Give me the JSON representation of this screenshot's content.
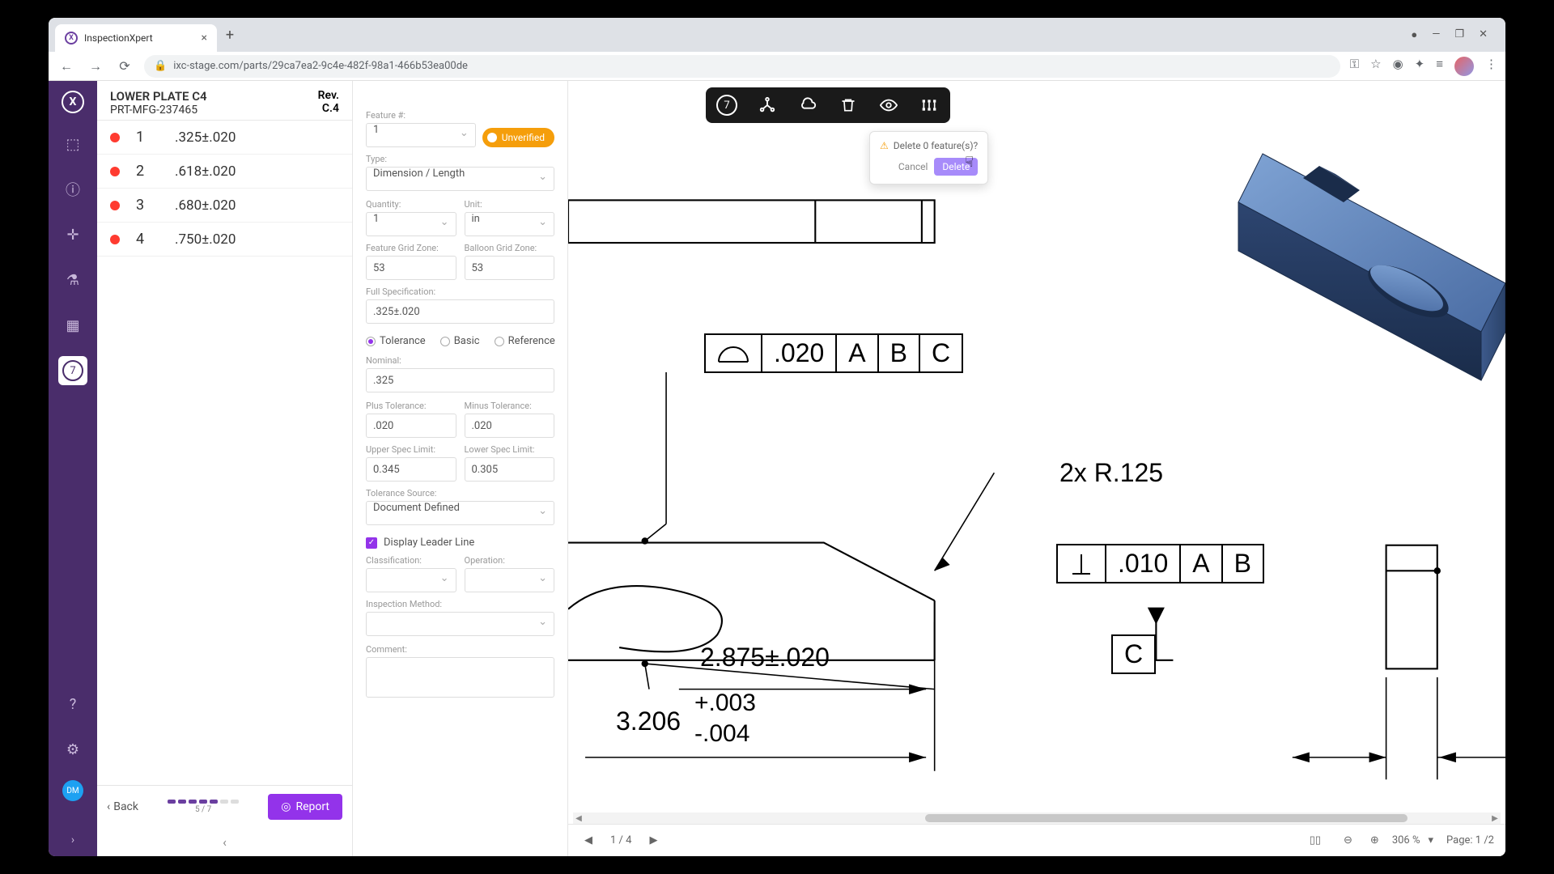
{
  "browser": {
    "tab_title": "InspectionXpert",
    "url": "ixc-stage.com/parts/29ca7ea2-9c4e-482f-98a1-466b53ea00de"
  },
  "part": {
    "name": "LOWER PLATE C4",
    "number": "PRT-MFG-237465",
    "rev_label": "Rev.",
    "rev": "C.4"
  },
  "features": [
    {
      "num": "1",
      "value": ".325±.020"
    },
    {
      "num": "2",
      "value": ".618±.020"
    },
    {
      "num": "3",
      "value": ".680±.020"
    },
    {
      "num": "4",
      "value": ".750±.020"
    }
  ],
  "sidebar_footer": {
    "back": "Back",
    "progress_text": "5 / 7",
    "report": "Report"
  },
  "inspector": {
    "feature_num_label": "Feature #:",
    "feature_num": "1",
    "status": "Unverified",
    "type_label": "Type:",
    "type": "Dimension / Length",
    "quantity_label": "Quantity:",
    "quantity": "1",
    "unit_label": "Unit:",
    "unit": "in",
    "fgz_label": "Feature Grid Zone:",
    "fgz": "53",
    "bgz_label": "Balloon Grid Zone:",
    "bgz": "53",
    "spec_label": "Full Specification:",
    "spec": ".325±.020",
    "tol_mode": {
      "tolerance": "Tolerance",
      "basic": "Basic",
      "reference": "Reference"
    },
    "nominal_label": "Nominal:",
    "nominal": ".325",
    "plus_tol_label": "Plus Tolerance:",
    "plus_tol": ".020",
    "minus_tol_label": "Minus Tolerance:",
    "minus_tol": ".020",
    "usl_label": "Upper Spec Limit:",
    "usl": "0.345",
    "lsl_label": "Lower Spec Limit:",
    "lsl": "0.305",
    "tol_source_label": "Tolerance Source:",
    "tol_source": "Document Defined",
    "leader_label": "Display Leader Line",
    "classification_label": "Classification:",
    "operation_label": "Operation:",
    "method_label": "Inspection Method:",
    "comment_label": "Comment:"
  },
  "popup": {
    "text": "Delete 0 feature(s)?",
    "cancel": "Cancel",
    "delete": "Delete"
  },
  "pager": {
    "text": "1 / 4"
  },
  "bottom": {
    "zoom": "306 %",
    "page": "Page: 1 /2"
  },
  "drawing": {
    "fcf1": {
      "tol": ".020",
      "a": "A",
      "b": "B",
      "c": "C"
    },
    "fcf2": {
      "tol": ".010",
      "a": "A",
      "b": "B"
    },
    "datum_c": "C",
    "radius_note": "2x R.125",
    "dim1": "2.875±.020",
    "dim2_nom": "3.206",
    "dim2_plus": "+.003",
    "dim2_minus": "-.004"
  },
  "rail": {
    "count": "7"
  }
}
